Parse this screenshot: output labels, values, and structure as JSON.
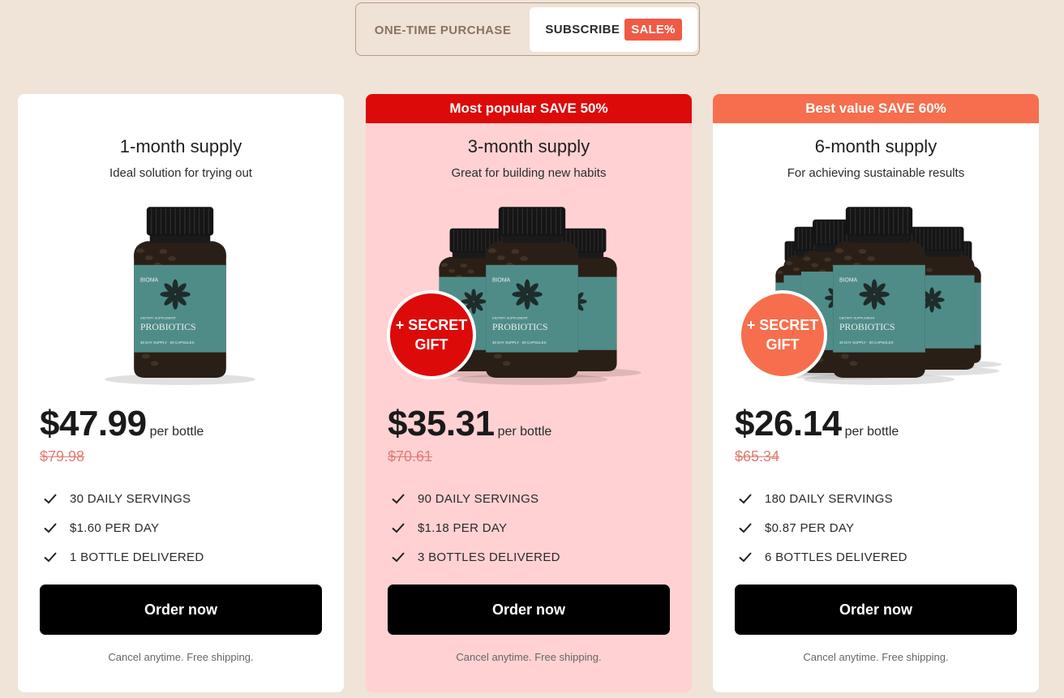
{
  "toggle": {
    "one_time_label": "ONE-TIME PURCHASE",
    "subscribe_label": "SUBSCRIBE",
    "sale_badge": "SALE%",
    "selected": "subscribe"
  },
  "colors": {
    "page_bg": "#f0e3d8",
    "popular_red": "#dd0a0a",
    "best_value_orange": "#f66e4d",
    "popular_card_bg": "#ffd1d2",
    "sale_badge": "#ef5a45",
    "button": "#000000"
  },
  "plans": [
    {
      "banner": "",
      "title": "1-month supply",
      "subtitle": "Ideal solution for trying out",
      "bottles": 1,
      "gift": "",
      "price": "$47.99",
      "per_unit": "per bottle",
      "old_price": "$79.98",
      "features": [
        "30 DAILY SERVINGS",
        "$1.60 PER DAY",
        "1 BOTTLE DELIVERED"
      ],
      "button_label": "Order now",
      "note": "Cancel anytime. Free shipping."
    },
    {
      "banner": "Most popular SAVE 50%",
      "title": "3-month supply",
      "subtitle": "Great for building new habits",
      "bottles": 3,
      "gift": "+ SECRET GIFT",
      "price": "$35.31",
      "per_unit": "per bottle",
      "old_price": "$70.61",
      "features": [
        "90 DAILY SERVINGS",
        "$1.18 PER DAY",
        "3 BOTTLES DELIVERED"
      ],
      "button_label": "Order now",
      "note": "Cancel anytime. Free shipping."
    },
    {
      "banner": "Best value SAVE 60%",
      "title": "6-month supply",
      "subtitle": "For achieving sustainable results",
      "bottles": 6,
      "gift": "+ SECRET GIFT",
      "price": "$26.14",
      "per_unit": "per bottle",
      "old_price": "$65.34",
      "features": [
        "180 DAILY SERVINGS",
        "$0.87 PER DAY",
        "6 BOTTLES DELIVERED"
      ],
      "button_label": "Order now",
      "note": "Cancel anytime. Free shipping."
    }
  ],
  "product_label": {
    "brand": "BIOMA",
    "name": "PROBIOTICS",
    "small": "DIETARY SUPPLEMENT",
    "count": "30 DAY SUPPLY · 60 CAPSULES"
  }
}
